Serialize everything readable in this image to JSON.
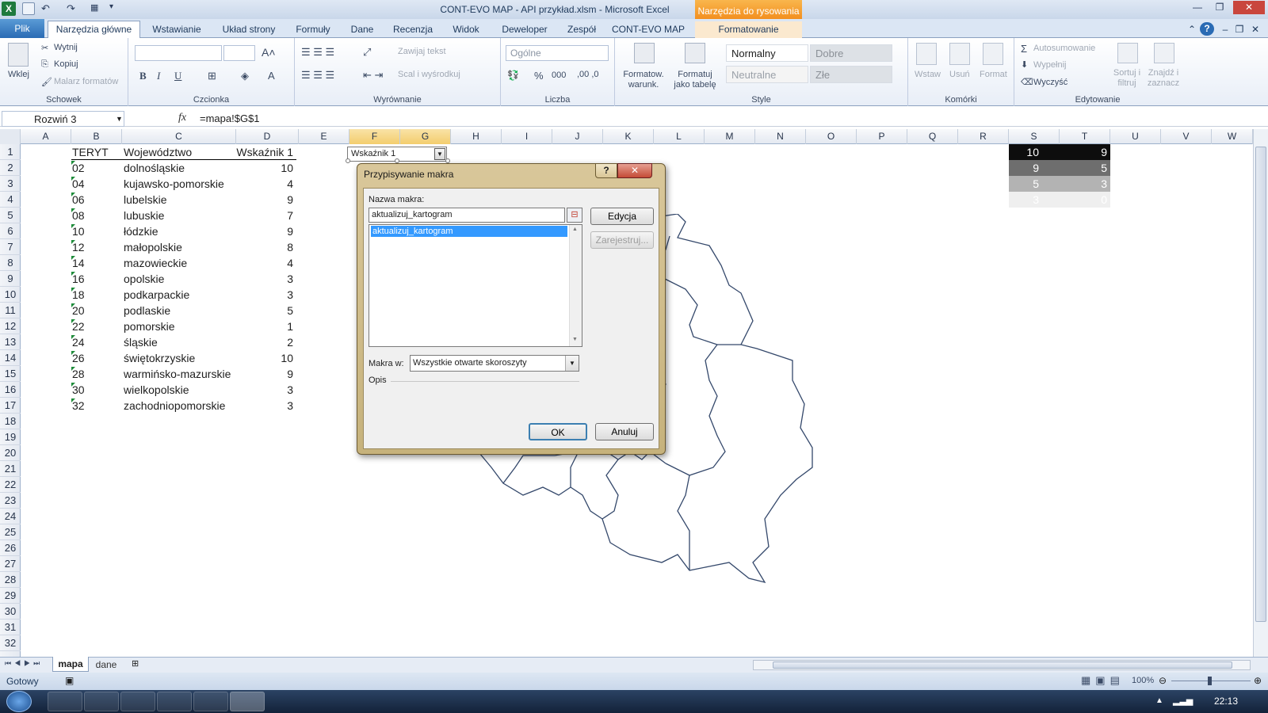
{
  "window": {
    "title": "CONT-EVO MAP - API przykład.xlsm - Microsoft Excel",
    "context_tab_header": "Narzędzia do rysowania",
    "app_icon_letter": "X"
  },
  "ribbon_tabs": [
    "Narzędzia główne",
    "Wstawianie",
    "Układ strony",
    "Formuły",
    "Dane",
    "Recenzja",
    "Widok",
    "Deweloper",
    "Zespół",
    "CONT-EVO MAP",
    "Formatowanie"
  ],
  "file_tab": "Plik",
  "ribbon": {
    "clipboard": {
      "paste": "Wklej",
      "cut": "Wytnij",
      "copy": "Kopiuj",
      "painter": "Malarz formatów",
      "label": "Schowek"
    },
    "font": {
      "label": "Czcionka",
      "bold": "B",
      "italic": "I",
      "underline": "U"
    },
    "alignment": {
      "wrap": "Zawijaj tekst",
      "merge": "Scal i wyśrodkuj",
      "label": "Wyrównanie"
    },
    "number": {
      "format": "Ogólne",
      "label": "Liczba",
      "percent": "%",
      "thousands": "000"
    },
    "styles": {
      "cond_format": "Formatow. warunk.",
      "as_table": "Formatuj jako tabelę",
      "normal": "Normalny",
      "good": "Dobre",
      "neutral": "Neutralne",
      "bad": "Złe",
      "label": "Style"
    },
    "cells": {
      "insert": "Wstaw",
      "delete": "Usuń",
      "format": "Format",
      "label": "Komórki"
    },
    "editing": {
      "autosum": "Autosumowanie",
      "fill": "Wypełnij",
      "clear": "Wyczyść",
      "sort": "Sortuj i filtruj",
      "find": "Znajdź i zaznacz",
      "label": "Edytowanie"
    }
  },
  "formula_bar": {
    "name_box": "Rozwiń 3",
    "fx": "fx",
    "formula": "=mapa!$G$1"
  },
  "columns": [
    "A",
    "B",
    "C",
    "D",
    "E",
    "F",
    "G",
    "H",
    "I",
    "J",
    "K",
    "L",
    "M",
    "N",
    "O",
    "P",
    "Q",
    "R",
    "S",
    "T",
    "U",
    "V",
    "W"
  ],
  "rows": [
    "1",
    "2",
    "3",
    "4",
    "5",
    "6",
    "7",
    "8",
    "9",
    "10",
    "11",
    "12",
    "13",
    "14",
    "15",
    "16",
    "17",
    "18",
    "19",
    "20",
    "21",
    "22",
    "23",
    "24",
    "25",
    "26",
    "27",
    "28",
    "29",
    "30",
    "31",
    "32"
  ],
  "table": {
    "headers": [
      "TERYT",
      "Województwo",
      "Wskaźnik 1"
    ],
    "records": [
      [
        "02",
        "dolnośląskie",
        "10"
      ],
      [
        "04",
        "kujawsko-pomorskie",
        "4"
      ],
      [
        "06",
        "lubelskie",
        "9"
      ],
      [
        "08",
        "lubuskie",
        "7"
      ],
      [
        "10",
        "łódzkie",
        "9"
      ],
      [
        "12",
        "małopolskie",
        "8"
      ],
      [
        "14",
        "mazowieckie",
        "4"
      ],
      [
        "16",
        "opolskie",
        "3"
      ],
      [
        "18",
        "podkarpackie",
        "3"
      ],
      [
        "20",
        "podlaskie",
        "5"
      ],
      [
        "22",
        "pomorskie",
        "1"
      ],
      [
        "24",
        "śląskie",
        "2"
      ],
      [
        "26",
        "świętokrzyskie",
        "10"
      ],
      [
        "28",
        "warmińsko-mazurskie",
        "9"
      ],
      [
        "30",
        "wielkopolskie",
        "3"
      ],
      [
        "32",
        "zachodniopomorskie",
        "3"
      ]
    ]
  },
  "dropdown_control": {
    "value": "Wskaźnik 1"
  },
  "legend_cells": [
    {
      "s": "10",
      "t": "9",
      "bg": "#0d0d0d",
      "fg": "#ffffff"
    },
    {
      "s": "9",
      "t": "5",
      "bg": "#6e6e6e",
      "fg": "#ffffff"
    },
    {
      "s": "5",
      "t": "3",
      "bg": "#b3b3b3",
      "fg": "#ffffff"
    },
    {
      "s": "3",
      "t": "0",
      "bg": "#efefef",
      "fg": "#ffffff"
    }
  ],
  "dialog": {
    "title": "Przypisywanie makra",
    "name_label": "Nazwa makra:",
    "name_value": "aktualizuj_kartogram",
    "list_items": [
      "aktualizuj_kartogram"
    ],
    "edit_button": "Edycja",
    "record_button": "Zarejestruj...",
    "macros_in_label": "Makra w:",
    "macros_in_value": "Wszystkie otwarte skoroszyty",
    "description_label": "Opis",
    "ok": "OK",
    "cancel": "Anuluj",
    "help": "?",
    "close": "✕"
  },
  "sheets": {
    "active": "mapa",
    "other": "dane"
  },
  "status": {
    "ready": "Gotowy",
    "zoom": "100%"
  },
  "taskbar": {
    "clock": "22:13"
  },
  "colors": {
    "accent": "#2a6bb4",
    "selection": "#3399ff",
    "map_stroke": "#34486b"
  }
}
